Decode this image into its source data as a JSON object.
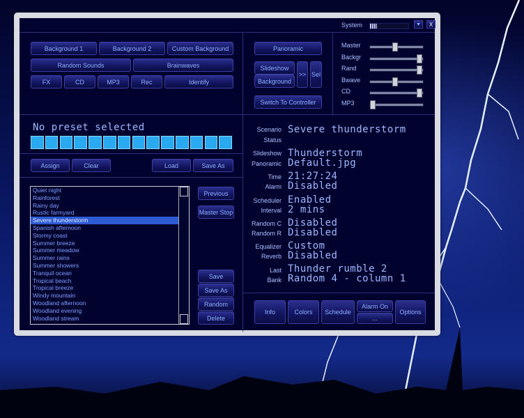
{
  "titlebar": {
    "system_label": "System",
    "minimize_label": "▼",
    "close_label": "X"
  },
  "top_buttons": {
    "background1": "Background 1",
    "background2": "Background 2",
    "custom_background": "Custom Background",
    "random_sounds": "Random Sounds",
    "brainwaves": "Brainwaves",
    "fx": "FX",
    "cd": "CD",
    "mp3": "MP3",
    "rec": "Rec",
    "identify": "Identify"
  },
  "display_buttons": {
    "panoramic": "Panoramic",
    "slideshow": "Slideshow",
    "background": "Background",
    "next": ">>",
    "sel": "Sel",
    "switch_controller": "Switch To Controller"
  },
  "mixer": {
    "channels": [
      {
        "label": "Master",
        "level": 0.45
      },
      {
        "label": "Backgr",
        "level": 0.95
      },
      {
        "label": "Rand",
        "level": 0.95
      },
      {
        "label": "Bwave",
        "level": 0.45
      },
      {
        "label": "CD",
        "level": 0.95
      },
      {
        "label": "MP3",
        "level": 0.0
      }
    ]
  },
  "preset": {
    "status_text": "No preset selected",
    "progress_segments": 14,
    "assign": "Assign",
    "clear": "Clear",
    "load": "Load",
    "save_as": "Save As"
  },
  "preset_list": {
    "items": [
      "Quiet night",
      "Rainforest",
      "Rainy day",
      "Rustic farmyard",
      "Severe thunderstorm",
      "Spanish afternoon",
      "Stormy coast",
      "Summer breeze",
      "Summer meadow",
      "Summer rains",
      "Summer showers",
      "Tranquil ocean",
      "Tropical beach",
      "Tropical breeze",
      "Windy mountain",
      "Woodland afternoon",
      "Woodland evening",
      "Woodland stream"
    ],
    "selected": "Severe thunderstorm"
  },
  "list_side_buttons": {
    "previous": "Previous",
    "master_stop": "Master Stop",
    "save": "Save",
    "save_as": "Save As",
    "random": "Random",
    "delete": "Delete"
  },
  "info": {
    "scenario_label": "Scenario",
    "scenario_value": "Severe thunderstorm",
    "status_label": "Status",
    "status_value": "",
    "slideshow_label": "Slideshow",
    "slideshow_value": "Thunderstorm",
    "panoramic_label": "Panoramic",
    "panoramic_value": "Default.jpg",
    "time_label": "Time",
    "time_value": "21:27:24",
    "alarm_label": "Alarm",
    "alarm_value": "Disabled",
    "scheduler_label": "Scheduler",
    "scheduler_value": "Enabled",
    "interval_label": "Interval",
    "interval_value": "2 mins",
    "random_c_label": "Random C",
    "random_c_value": "Disabled",
    "random_r_label": "Random R",
    "random_r_value": "Disabled",
    "equalizer_label": "Equalizer",
    "equalizer_value": "Custom",
    "reverb_label": "Reverb",
    "reverb_value": "Disabled",
    "last_label": "Last",
    "last_value": "Thunder rumble 2",
    "bank_label": "Bank",
    "bank_value": "Random 4 - column 1"
  },
  "bottom_buttons": {
    "info": "Info",
    "colors": "Colors",
    "schedule": "Schedule",
    "alarm_on": "Alarm On",
    "alarm_more": "...",
    "options": "Options"
  },
  "colors": {
    "panel": "#02022e",
    "text": "#9bb8ff",
    "progress": "#28a9f0",
    "window_frame": "#d9dbe2"
  }
}
